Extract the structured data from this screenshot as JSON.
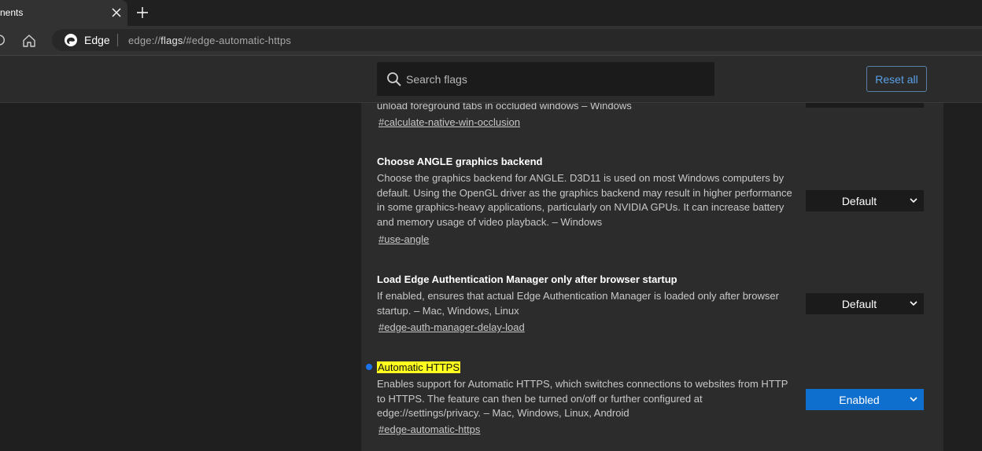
{
  "tab": {
    "title": "nents",
    "close_icon": "close-icon",
    "new_tab_icon": "plus-icon"
  },
  "toolbar": {
    "site_name": "Edge",
    "url_prefix": "edge://",
    "url_host": "flags",
    "url_rest": "/#edge-automatic-https"
  },
  "header": {
    "search_placeholder": "Search flags",
    "reset_label": "Reset all"
  },
  "experiments": [
    {
      "title": "",
      "description": "unload foreground tabs in occluded windows – Windows",
      "link": "#calculate-native-win-occlusion",
      "select": ""
    },
    {
      "title": "Choose ANGLE graphics backend",
      "description": "Choose the graphics backend for ANGLE. D3D11 is used on most Windows computers by default. Using the OpenGL driver as the graphics backend may result in higher performance in some graphics-heavy applications, particularly on NVIDIA GPUs. It can increase battery and memory usage of video playback. – Windows",
      "link": "#use-angle",
      "select": "Default"
    },
    {
      "title": "Load Edge Authentication Manager only after browser startup",
      "description": "If enabled, ensures that actual Edge Authentication Manager is loaded only after browser startup. – Mac, Windows, Linux",
      "link": "#edge-auth-manager-delay-load",
      "select": "Default"
    },
    {
      "title": "Automatic HTTPS",
      "description": "Enables support for Automatic HTTPS, which switches connections to websites from HTTP to HTTPS. The feature can then be turned on/off or further configured at edge://settings/privacy. – Mac, Windows, Linux, Android",
      "link": "#edge-automatic-https",
      "select": "Enabled"
    }
  ],
  "colors": {
    "accent": "#0f6fce",
    "highlight": "#ffff1f",
    "modified_dot": "#1a73e8"
  }
}
